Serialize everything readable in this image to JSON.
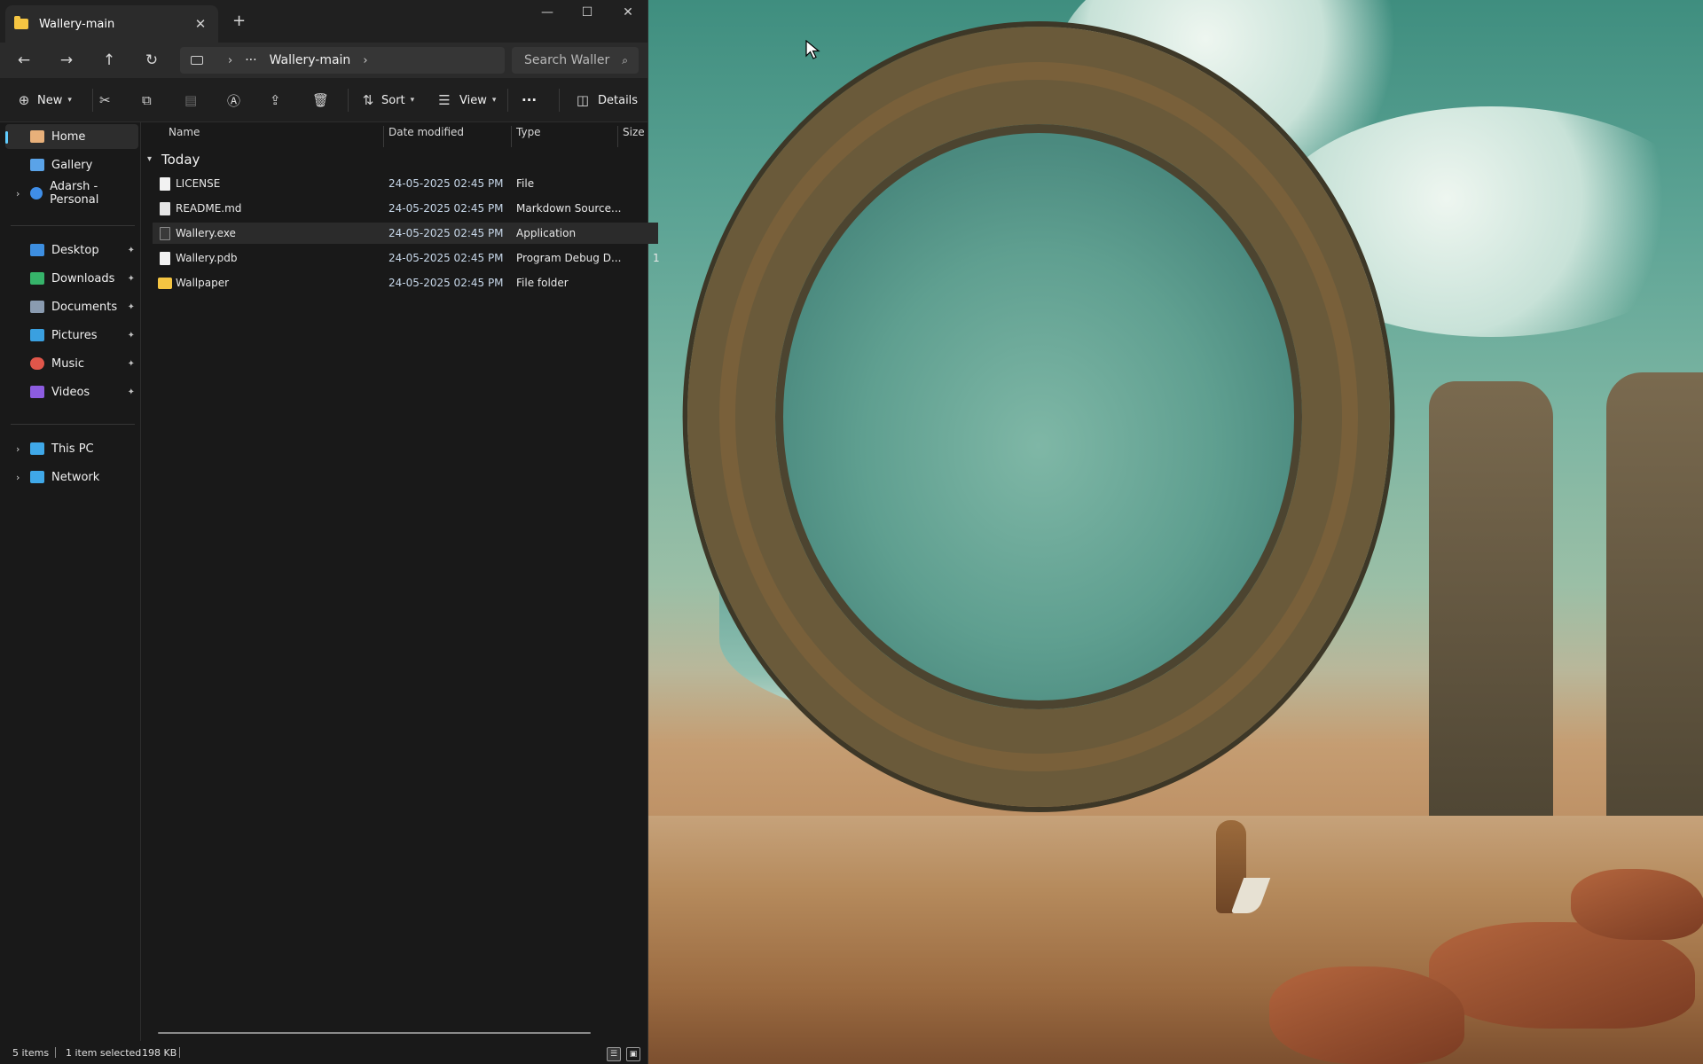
{
  "window": {
    "tab_title": "Wallery-main",
    "tab_close": "✕",
    "new_tab": "+",
    "controls": {
      "minimize": "—",
      "maximize": "☐",
      "close": "✕"
    }
  },
  "navigation": {
    "back": "←",
    "forward": "→",
    "up": "↑",
    "refresh": "↻",
    "breadcrumb_more": "···",
    "breadcrumb_current": "Wallery-main",
    "search_placeholder": "Search Waller"
  },
  "toolbar": {
    "new_label": "New",
    "sort_label": "Sort",
    "view_label": "View",
    "more_label": "···",
    "details_label": "Details"
  },
  "sidebar": {
    "items": [
      {
        "label": "Home",
        "icon": "home-icon",
        "color": "#e8b07a"
      },
      {
        "label": "Gallery",
        "icon": "gallery-icon",
        "color": "#5aa3e8"
      },
      {
        "label": "Adarsh - Personal",
        "icon": "onedrive-icon",
        "color": "#3f8ee8"
      },
      {
        "label": "Desktop",
        "icon": "desktop-icon",
        "color": "#3d8ee0"
      },
      {
        "label": "Downloads",
        "icon": "downloads-icon",
        "color": "#36b36a"
      },
      {
        "label": "Documents",
        "icon": "documents-icon",
        "color": "#8a9bb0"
      },
      {
        "label": "Pictures",
        "icon": "pictures-icon",
        "color": "#3aa0e0"
      },
      {
        "label": "Music",
        "icon": "music-icon",
        "color": "#e0564a"
      },
      {
        "label": "Videos",
        "icon": "videos-icon",
        "color": "#8c5ce0"
      },
      {
        "label": "This PC",
        "icon": "this-pc-icon",
        "color": "#3fa8e8"
      },
      {
        "label": "Network",
        "icon": "network-icon",
        "color": "#3fa8e8"
      }
    ]
  },
  "columns": {
    "name": "Name",
    "date": "Date modified",
    "type": "Type",
    "size": "Size"
  },
  "group": {
    "title": "Today"
  },
  "files": [
    {
      "name": "LICENSE",
      "date": "24-05-2025 02:45 PM",
      "type": "File",
      "size": ""
    },
    {
      "name": "README.md",
      "date": "24-05-2025 02:45 PM",
      "type": "Markdown Source...",
      "size": ""
    },
    {
      "name": "Wallery.exe",
      "date": "24-05-2025 02:45 PM",
      "type": "Application",
      "size": ""
    },
    {
      "name": "Wallery.pdb",
      "date": "24-05-2025 02:45 PM",
      "type": "Program Debug D...",
      "size": "1"
    },
    {
      "name": "Wallpaper",
      "date": "24-05-2025 02:45 PM",
      "type": "File folder",
      "size": ""
    }
  ],
  "status": {
    "items_count": "5 items",
    "selected": "1 item selected",
    "selected_size": "198 KB"
  }
}
